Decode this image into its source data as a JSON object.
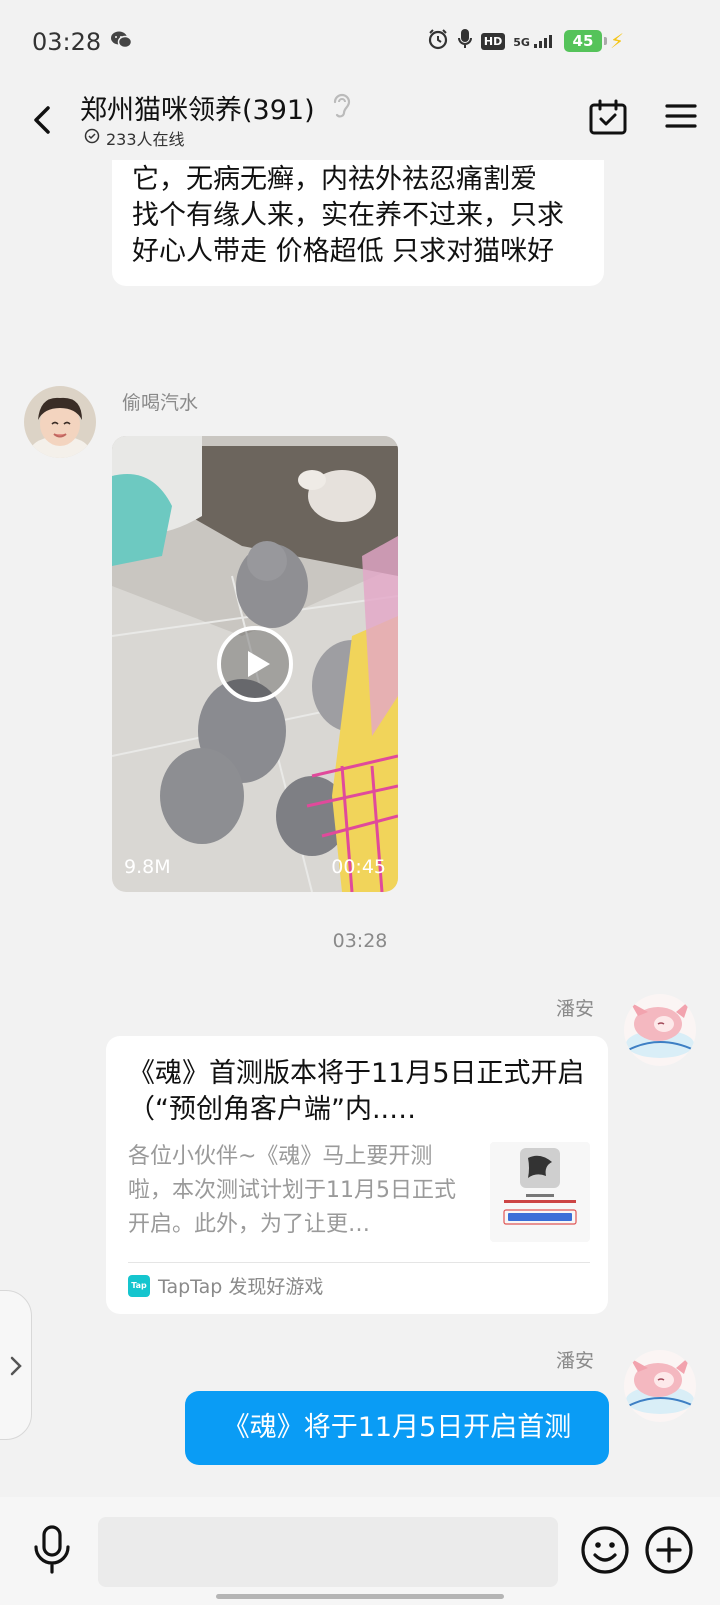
{
  "status_bar": {
    "time": "03:28",
    "hd_label": "HD",
    "network_label": "5G",
    "battery_level": "45"
  },
  "header": {
    "title": "郑州猫咪领养(391)",
    "online_count": "233人在线"
  },
  "messages": {
    "first_text": "它，无病无癣，内祛外祛忍痛割爱\n找个有缘人来，实在养不过来，只求好心人带走 价格超低 只求对猫咪好",
    "video_sender": "偷喝汽水",
    "video_size": "9.8M",
    "video_duration": "00:45",
    "divider_time": "03:28",
    "link_sender": "潘安",
    "link_title": "《魂》首测版本将于11月5日正式开启（“预创角客户端”内..…",
    "link_desc": "各位小伙伴~《魂》马上要开测啦，本次测试计划于11月5日正式开启。此外，为了让更…",
    "link_source": "TapTap 发现好游戏",
    "last_sender": "潘安",
    "last_text": "《魂》将于11月5日开启首测"
  },
  "colors": {
    "accent_blue": "#0a9cf5",
    "background": "#f2f2f2",
    "bubble_white": "#ffffff",
    "battery_green": "#55c35a"
  },
  "icons": [
    "wechat-icon",
    "alarm-icon",
    "mic-status-icon",
    "signal-icon",
    "back-icon",
    "ear-icon",
    "online-icon",
    "calendar-check-icon",
    "menu-icon",
    "play-icon",
    "taptap-icon",
    "chevron-right-icon",
    "mic-icon",
    "emoji-icon",
    "plus-icon"
  ]
}
